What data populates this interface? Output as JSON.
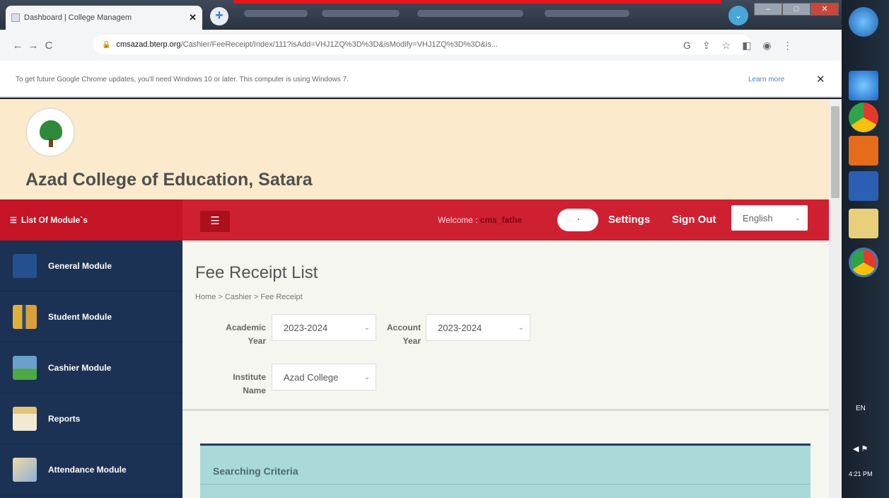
{
  "browser": {
    "tab_title": "Dashboard | College Managem",
    "tab_close": "✕",
    "new_tab": "+",
    "url_host": "cmsazad.bterp.org",
    "url_path": "/Cashier/FeeReceipt/Index/111?isAdd=VHJ1ZQ%3D%3D&isModify=VHJ1ZQ%3D%3D&is...",
    "nav_back": "←",
    "nav_forward": "→",
    "nav_reload": "C",
    "infobar_message": "To get future Google Chrome updates, you'll need Windows 10 or later. This computer is using Windows 7.",
    "infobar_link": "Learn more",
    "infobar_close": "✕"
  },
  "header": {
    "college_name": "Azad College of Education, Satara"
  },
  "topbar": {
    "module_list_label": "List Of Module`s",
    "welcome_label": "Welcome : ",
    "username": "cms_fathe",
    "settings": "Settings",
    "sign_out": "Sign Out",
    "language": "English"
  },
  "sidebar": {
    "items": [
      {
        "label": "General Module",
        "icon": "document-icon"
      },
      {
        "label": "Student Module",
        "icon": "students-icon"
      },
      {
        "label": "Cashier Module",
        "icon": "cashier-icon"
      },
      {
        "label": "Reports",
        "icon": "reports-icon"
      },
      {
        "label": "Attendance Module",
        "icon": "attendance-icon"
      }
    ]
  },
  "main": {
    "title": "Fee Receipt List",
    "breadcrumb": "Home > Cashier > Fee Receipt",
    "filters": {
      "academic_year_label_1": "Academic",
      "academic_year_label_2": "Year",
      "academic_year_value": "2023-2024",
      "account_year_label_1": "Account",
      "account_year_label_2": "Year",
      "account_year_value": "2023-2024",
      "institute_label_1": "Institute",
      "institute_label_2": "Name",
      "institute_value": "Azad College"
    },
    "searching_criteria": "Searching Criteria"
  },
  "taskbar": {
    "language": "EN",
    "clock": "4:21 PM"
  },
  "colors": {
    "topbar_red": "#cf2031",
    "sidebar_navy": "#1c3254",
    "header_cream": "#fbeacb",
    "panel_teal": "#a9d9d8"
  }
}
